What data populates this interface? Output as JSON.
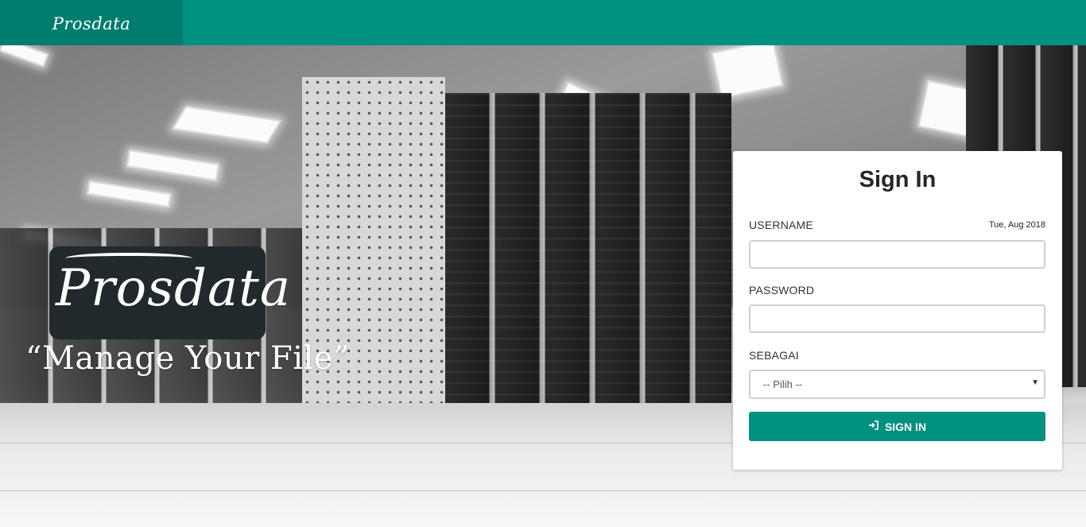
{
  "header": {
    "brand": "Prosdata"
  },
  "hero": {
    "logo_text": "Prosdata",
    "tagline": "“Manage Your File”"
  },
  "login": {
    "title": "Sign In",
    "date": "Tue, Aug 2018",
    "username_label": "USERNAME",
    "username_value": "",
    "password_label": "PASSWORD",
    "password_value": "",
    "role_label": "SEBAGAI",
    "role_selected": "-- Pilih --",
    "submit_label": "SIGN IN",
    "submit_icon": "sign-in-icon",
    "accent_color": "#00917f"
  }
}
